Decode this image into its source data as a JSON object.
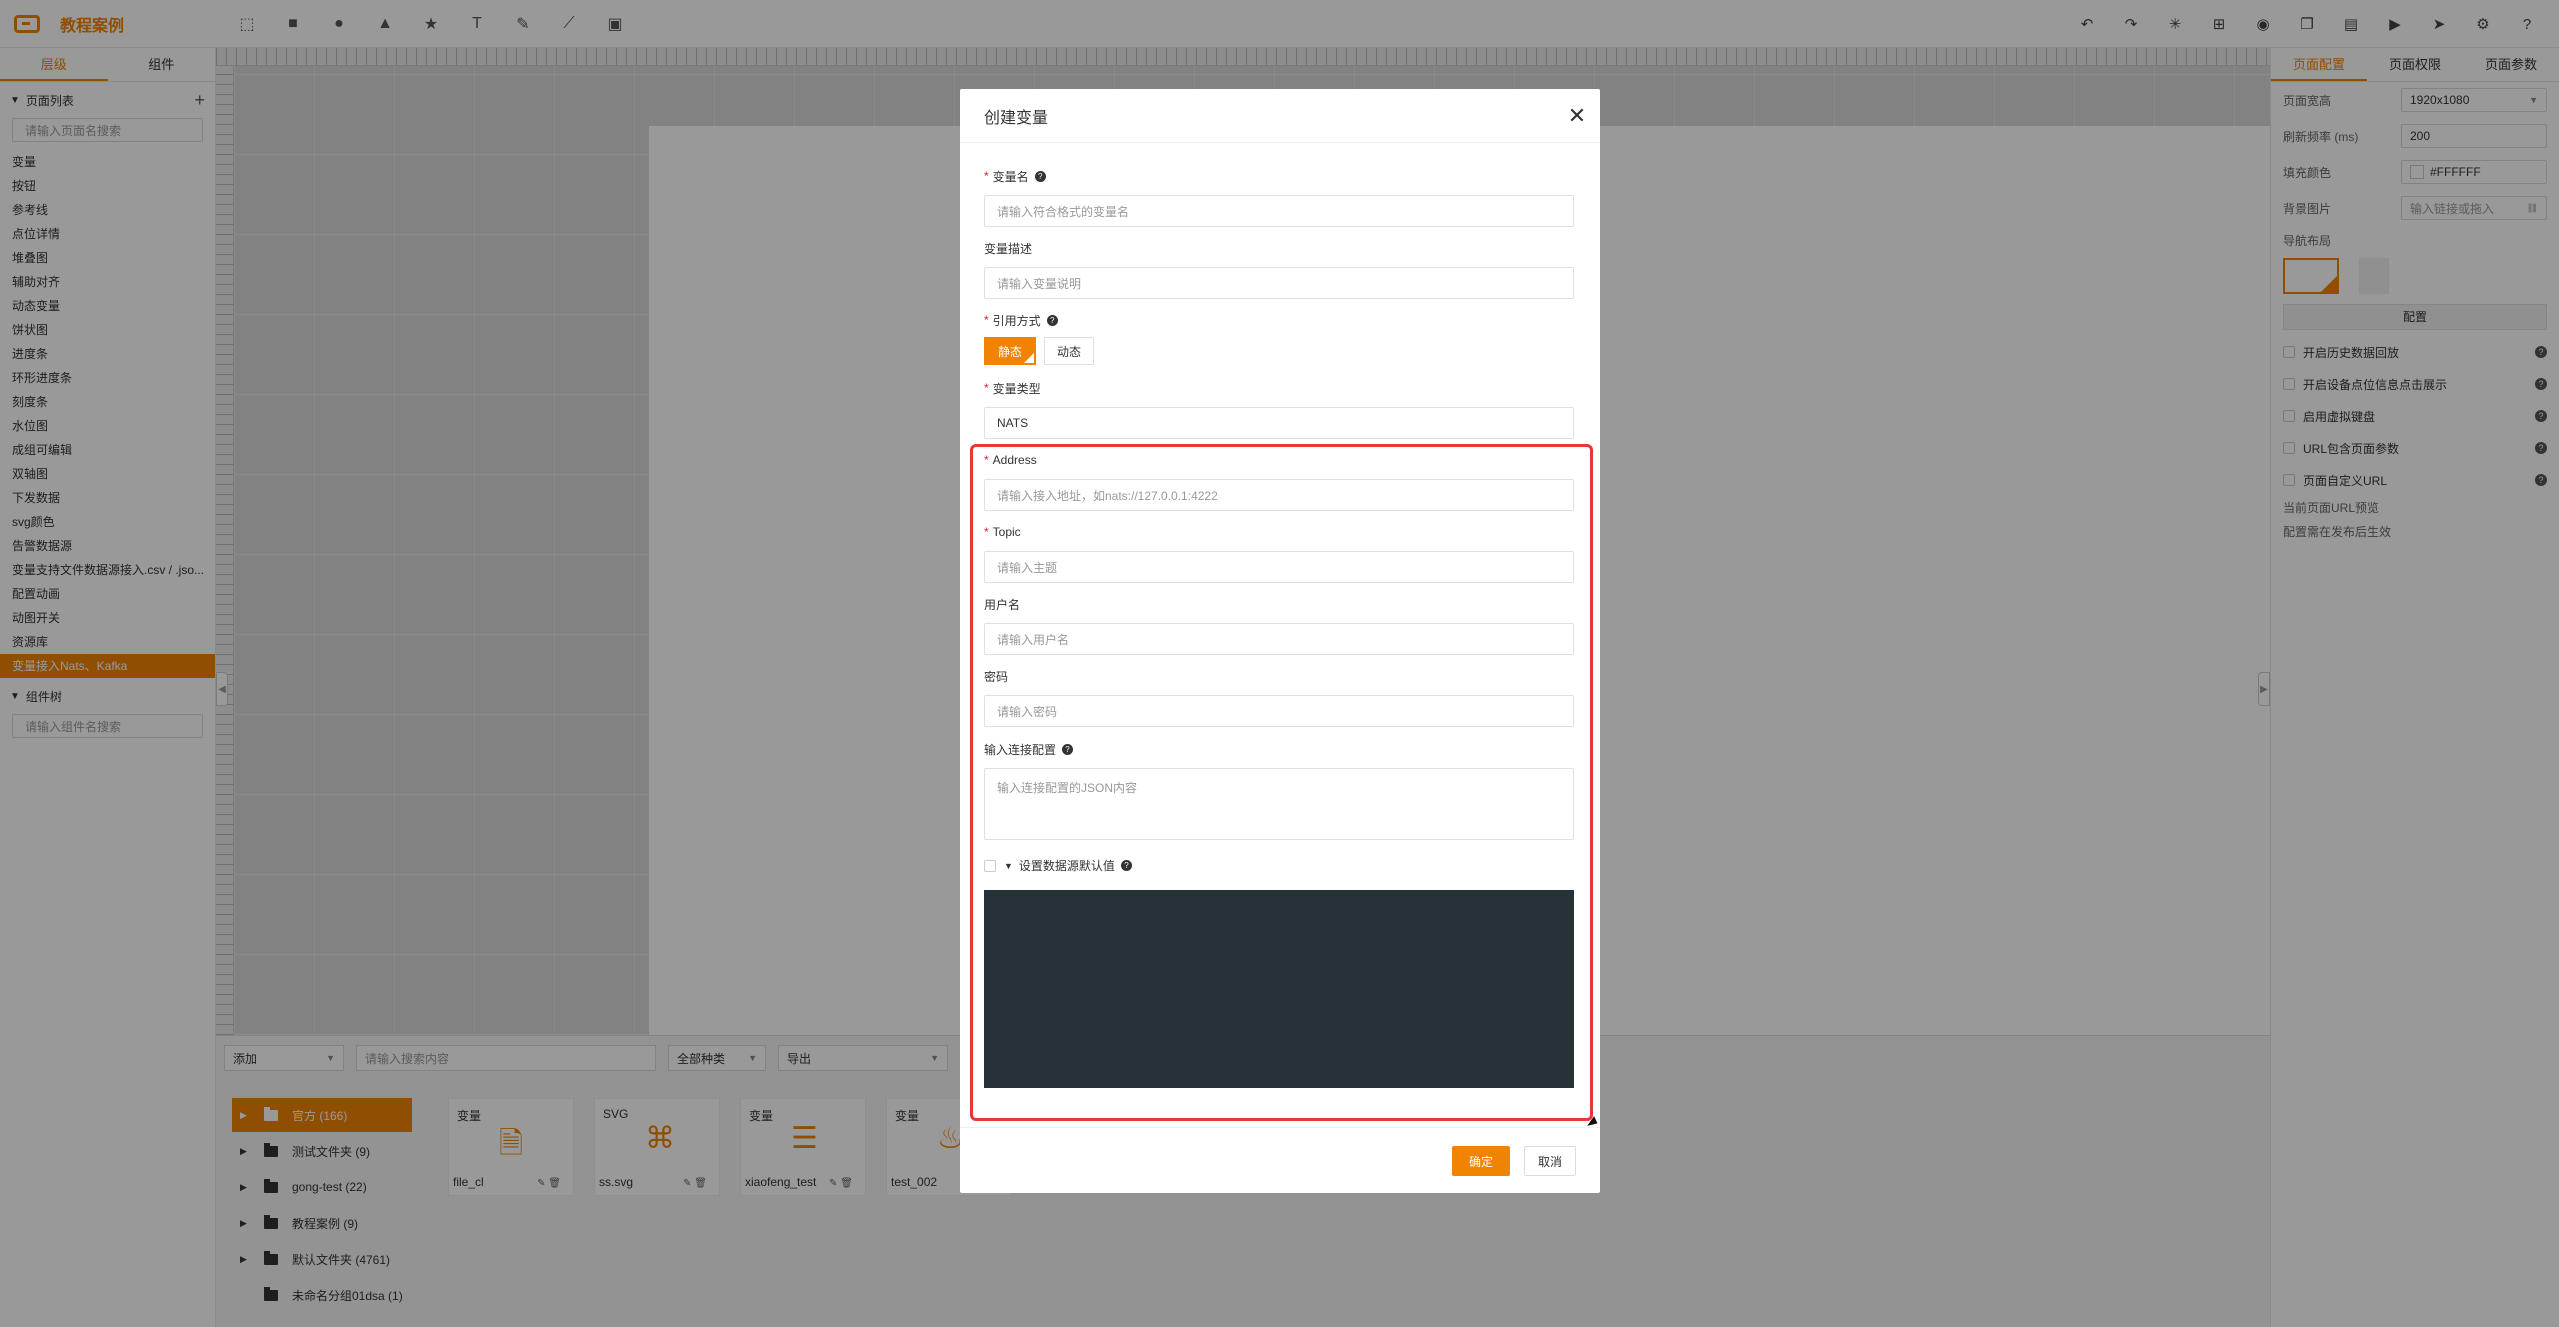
{
  "app": {
    "title": "教程案例"
  },
  "toolbar": {
    "tools": [
      "select-tool-icon",
      "rect-tool-icon",
      "circle-tool-icon",
      "triangle-tool-icon",
      "star-tool-icon",
      "text-tool-icon",
      "pen-tool-icon",
      "connector-tool-icon",
      "image-tool-icon"
    ],
    "tool_glyphs": [
      "⬚",
      "■",
      "●",
      "▲",
      "★",
      "T",
      "✎",
      "⟋",
      "▣"
    ],
    "right_tools": [
      "undo-icon",
      "redo-icon",
      "star-burst-icon",
      "grid-icon",
      "eye-icon",
      "copy-icon",
      "save-icon",
      "preview-icon",
      "publish-icon",
      "settings-icon",
      "help-icon"
    ],
    "right_glyphs": [
      "↶",
      "↷",
      "✳",
      "⊞",
      "◉",
      "❐",
      "▤",
      "▶",
      "➤",
      "⚙",
      "?"
    ]
  },
  "left_panel": {
    "tabs": [
      "层级",
      "组件"
    ],
    "page_list_title": "页面列表",
    "page_search_placeholder": "请输入页面名搜索",
    "pages": [
      "变量",
      "按钮",
      "参考线",
      "点位详情",
      "堆叠图",
      "辅助对齐",
      "动态变量",
      "饼状图",
      "进度条",
      "环形进度条",
      "刻度条",
      "水位图",
      "成组可编辑",
      "双轴图",
      "下发数据",
      "svg颜色",
      "告警数据源",
      "变量支持文件数据源接入.csv / .jso...",
      "配置动画",
      "动图开关",
      "资源库",
      "变量接入Nats、Kafka"
    ],
    "active_page_index": 21,
    "component_tree_title": "组件树",
    "component_search_placeholder": "请输入组件名搜索"
  },
  "right_panel": {
    "tabs": [
      "页面配置",
      "页面权限",
      "页面参数"
    ],
    "page_size_label": "页面宽高",
    "page_size_value": "1920x1080",
    "refresh_label": "刷新频率 (ms)",
    "refresh_value": "200",
    "fill_label": "填充颜色",
    "fill_value": "#FFFFFF",
    "bg_image_label": "背景图片",
    "bg_image_placeholder": "输入链接或拖入",
    "nav_layout_label": "导航布局",
    "config_button": "配置",
    "options": [
      "开启历史数据回放",
      "开启设备点位信息点击展示",
      "启用虚拟键盘",
      "URL包含页面参数",
      "页面自定义URL"
    ],
    "current_url_label": "当前页面URL预览",
    "current_url_note": "配置需在发布后生效"
  },
  "bottom_panel": {
    "add_label": "添加",
    "search_placeholder": "请输入搜索内容",
    "type_filter": "全部种类",
    "export_label": "导出",
    "folders": [
      {
        "name": "官方 (166)",
        "has_arrow": true,
        "active": true
      },
      {
        "name": "测试文件夹 (9)",
        "has_arrow": true,
        "active": false
      },
      {
        "name": "gong-test (22)",
        "has_arrow": true,
        "active": false
      },
      {
        "name": "教程案例 (9)",
        "has_arrow": true,
        "active": false
      },
      {
        "name": "默认文件夹 (4761)",
        "has_arrow": true,
        "active": false
      },
      {
        "name": "未命名分组01dsa (1)",
        "has_arrow": false,
        "active": false
      }
    ],
    "cards": [
      {
        "type": "变量",
        "name": "file_cl",
        "icon": "file-icon",
        "glyph": "🗎"
      },
      {
        "type": "SVG",
        "name": "ss.svg",
        "icon": "svg-icon",
        "glyph": "⌘"
      },
      {
        "type": "变量",
        "name": "xiaofeng_test",
        "icon": "server-icon",
        "glyph": "☰"
      },
      {
        "type": "变量",
        "name": "test_002",
        "icon": "alarm-icon",
        "glyph": "♨"
      }
    ]
  },
  "modal": {
    "title": "创建变量",
    "var_name_label": "变量名",
    "var_name_placeholder": "请输入符合格式的变量名",
    "var_desc_label": "变量描述",
    "var_desc_placeholder": "请输入变量说明",
    "ref_label": "引用方式",
    "ref_options": [
      "静态",
      "动态"
    ],
    "ref_selected": "静态",
    "type_label": "变量类型",
    "type_value": "NATS",
    "address_label": "Address",
    "address_placeholder": "请输入接入地址，如nats://127.0.0.1:4222",
    "topic_label": "Topic",
    "topic_placeholder": "请输入主题",
    "username_label": "用户名",
    "username_placeholder": "请输入用户名",
    "password_label": "密码",
    "password_placeholder": "请输入密码",
    "conn_config_label": "输入连接配置",
    "conn_config_placeholder": "输入连接配置的JSON内容",
    "default_value_label": "设置数据源默认值",
    "ok_button": "确定",
    "cancel_button": "取消"
  },
  "colors": {
    "accent": "#f08300",
    "highlight": "#e53935",
    "editor_bg": "#263238"
  }
}
